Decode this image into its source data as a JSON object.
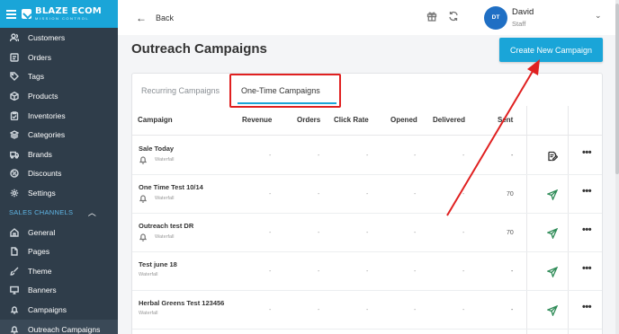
{
  "sidebar": {
    "brand_name": "BLAZE ECOM",
    "brand_sub": "MISSION CONTROL",
    "items": [
      {
        "label": "Customers",
        "icon": "customers-icon"
      },
      {
        "label": "Orders",
        "icon": "orders-icon"
      },
      {
        "label": "Tags",
        "icon": "tag-icon"
      },
      {
        "label": "Products",
        "icon": "box-icon"
      },
      {
        "label": "Inventories",
        "icon": "clipboard-icon"
      },
      {
        "label": "Categories",
        "icon": "layers-icon"
      },
      {
        "label": "Brands",
        "icon": "truck-icon"
      },
      {
        "label": "Discounts",
        "icon": "discount-icon"
      },
      {
        "label": "Settings",
        "icon": "gear-icon"
      }
    ],
    "section_label": "SALES CHANNELS",
    "channel_items": [
      {
        "label": "General",
        "icon": "home-icon"
      },
      {
        "label": "Pages",
        "icon": "pages-icon"
      },
      {
        "label": "Theme",
        "icon": "brush-icon"
      },
      {
        "label": "Banners",
        "icon": "monitor-icon"
      },
      {
        "label": "Campaigns",
        "icon": "bell-icon"
      },
      {
        "label": "Outreach Campaigns",
        "icon": "bell-icon"
      }
    ]
  },
  "topbar": {
    "back_label": "Back",
    "user": {
      "initials": "DT",
      "name": "David",
      "role": "Staff"
    }
  },
  "page": {
    "title": "Outreach Campaigns",
    "create_button": "Create New Campaign"
  },
  "tabs": [
    {
      "label": "Recurring Campaigns",
      "active": false
    },
    {
      "label": "One-Time Campaigns",
      "active": true
    }
  ],
  "table": {
    "columns": [
      "Campaign",
      "Revenue",
      "Orders",
      "Click Rate",
      "Opened",
      "Delivered",
      "Sent"
    ],
    "rows": [
      {
        "name": "Sale Today",
        "type": "Waterfall",
        "revenue": "-",
        "orders": "-",
        "click_rate": "-",
        "opened": "-",
        "delivered": "-",
        "sent": "-",
        "action": "edit-icon"
      },
      {
        "name": "One Time Test 10/14",
        "type": "Waterfall",
        "revenue": "-",
        "orders": "-",
        "click_rate": "-",
        "opened": "-",
        "delivered": "-",
        "sent": "70",
        "action": "send-icon"
      },
      {
        "name": "Outreach test DR",
        "type": "Waterfall",
        "revenue": "-",
        "orders": "-",
        "click_rate": "-",
        "opened": "-",
        "delivered": "-",
        "sent": "70",
        "action": "send-icon"
      },
      {
        "name": "Test june 18",
        "type": "Waterfall",
        "revenue": "-",
        "orders": "-",
        "click_rate": "-",
        "opened": "-",
        "delivered": "-",
        "sent": "-",
        "action": "send-icon"
      },
      {
        "name": "Herbal Greens Test 123456",
        "type": "Waterfall",
        "revenue": "-",
        "orders": "-",
        "click_rate": "-",
        "opened": "-",
        "delivered": "-",
        "sent": "-",
        "action": "send-icon"
      }
    ],
    "more_label": "•••"
  },
  "colors": {
    "accent": "#1aa5d8",
    "sidebar_bg": "#2f3d4a",
    "annotation": "#e02020",
    "send_icon": "#2e8b57"
  }
}
